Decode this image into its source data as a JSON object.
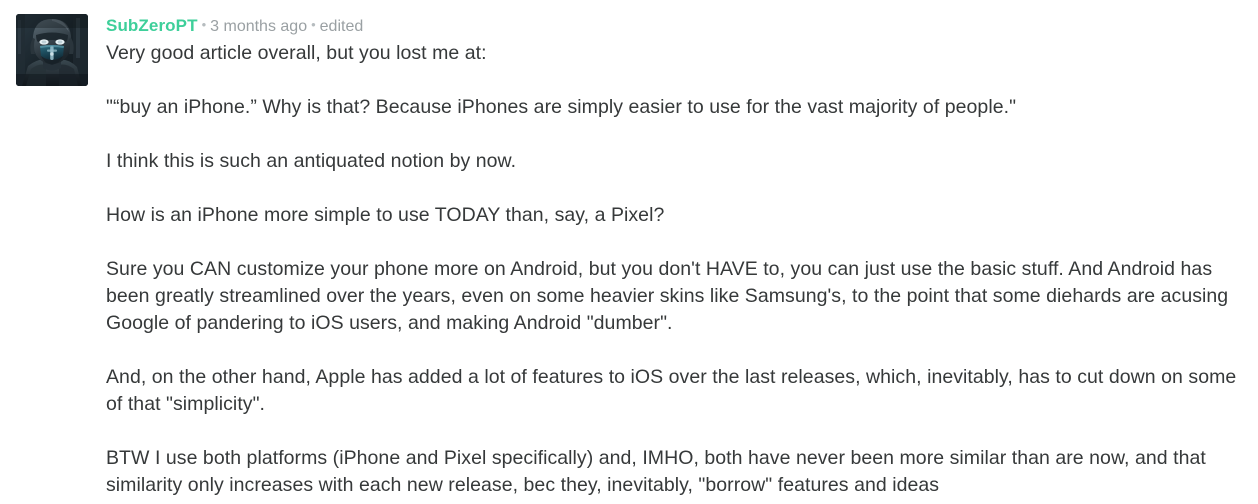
{
  "comment": {
    "author": "SubZeroPT",
    "separator": "•",
    "timestamp": "3 months ago",
    "edited_label": "edited",
    "avatar_alt": "sub-zero-avatar",
    "accent_color": "#3ecf9a",
    "meta_color": "#9aa0a3",
    "body_color": "#36393a",
    "paragraphs": [
      "Very good article overall, but you lost me at:",
      "\"“buy an iPhone.” Why is that? Because iPhones are simply easier to use for the vast majority of people.\"",
      "I think this is such an antiquated notion by now.",
      "How is an iPhone more simple to use TODAY than, say, a Pixel?",
      "Sure you CAN customize your phone more on Android, but you don't HAVE to, you can just use the basic stuff. And Android has been greatly streamlined over the years, even on some heavier skins like Samsung's, to the point that some diehards are acusing Google of pandering to iOS users, and making Android \"dumber\".",
      "And, on the other hand, Apple has added a lot of features to iOS over the last releases, which, inevitably, has to cut down on some of that \"simplicity\".",
      "BTW I use both platforms (iPhone and Pixel specifically) and, IMHO, both have never been more similar than are now, and that similarity only increases with each new release, bec they, inevitably, \"borrow\" features and ideas"
    ]
  }
}
